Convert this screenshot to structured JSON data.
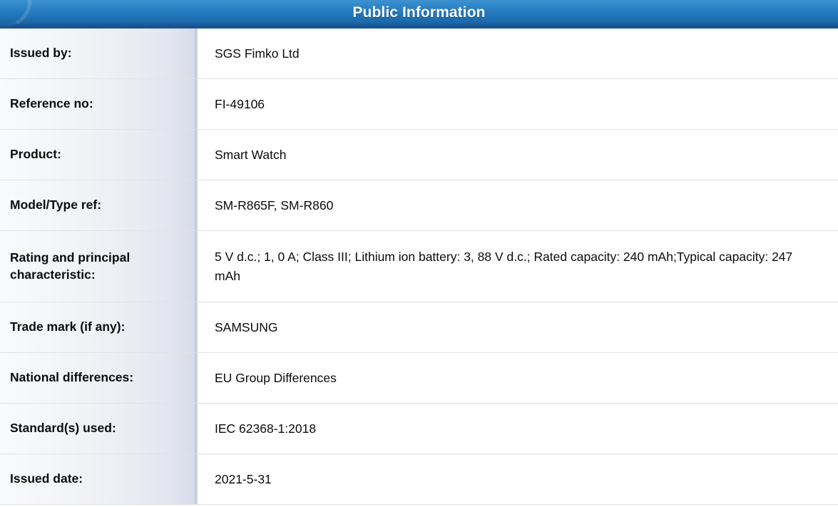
{
  "header": {
    "title": "Public Information",
    "logo_icon": "circle-swoosh-logo-icon",
    "background_color": "#2278bc",
    "border_color": "#1a5490",
    "title_color": "#ffffff"
  },
  "table": {
    "label_column_color": "#eceef4",
    "value_column_color": "#ffffff",
    "row_divider_color": "#e2e2e4",
    "rows": [
      {
        "label": "Issued by:",
        "value": "SGS Fimko Ltd",
        "size": "normal"
      },
      {
        "label": "Reference no:",
        "value": "FI-49106",
        "size": "normal"
      },
      {
        "label": "Product:",
        "value": "Smart Watch",
        "size": "normal"
      },
      {
        "label": "Model/Type ref:",
        "value": "SM-R865F, SM-R860",
        "size": "normal"
      },
      {
        "label": "Rating and principal characteristic:",
        "value": "5 V d.c.; 1, 0 A; Class III; Lithium ion battery: 3, 88 V d.c.; Rated capacity: 240 mAh;Typical capacity: 247 mAh",
        "size": "tall"
      },
      {
        "label": "Trade mark (if any):",
        "value": "SAMSUNG",
        "size": "normal"
      },
      {
        "label": "National differences:",
        "value": "EU Group Differences",
        "size": "normal"
      },
      {
        "label": "Standard(s) used:",
        "value": "IEC 62368-1:2018",
        "size": "normal"
      },
      {
        "label": "Issued date:",
        "value": "2021-5-31",
        "size": "normal"
      }
    ]
  }
}
